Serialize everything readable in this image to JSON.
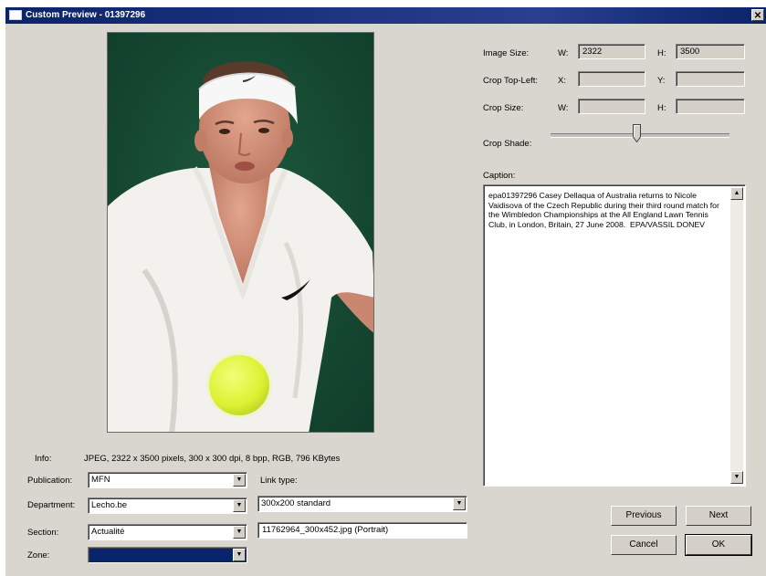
{
  "window": {
    "title": "Custom Preview - 01397296",
    "close_glyph": "✕"
  },
  "image_size": {
    "label": "Image Size:",
    "w_label": "W:",
    "w_value": "2322",
    "h_label": "H:",
    "h_value": "3500"
  },
  "crop_top_left": {
    "label": "Crop Top-Left:",
    "x_label": "X:",
    "x_value": "",
    "y_label": "Y:",
    "y_value": ""
  },
  "crop_size": {
    "label": "Crop Size:",
    "w_label": "W:",
    "w_value": "",
    "h_label": "H:",
    "h_value": ""
  },
  "crop_shade": {
    "label": "Crop Shade:",
    "level": 0.48
  },
  "caption": {
    "label": "Caption:",
    "text": "epa01397296 Casey Dellaqua of Australia returns to Nicole Vaidisova of the Czech Republic during their third round match for the Wimbledon Championships at the All England Lawn Tennis Club, in London, Britain, 27 June 2008.  EPA/VASSIL DONEV"
  },
  "info": {
    "label": "Info:",
    "value": "JPEG, 2322 x 3500 pixels, 300 x 300 dpi, 8 bpp, RGB, 796 KBytes"
  },
  "publication": {
    "label": "Publication:",
    "value": "MFN"
  },
  "department": {
    "label": "Department:",
    "value": "Lecho.be"
  },
  "section": {
    "label": "Section:",
    "value": "Actualité"
  },
  "zone": {
    "label": "Zone:",
    "value": ""
  },
  "link_type": {
    "label": "Link type:",
    "value": "300x200 standard",
    "file": "11762964_300x452.jpg (Portrait)"
  },
  "buttons": {
    "previous": "Previous",
    "next": "Next",
    "cancel": "Cancel",
    "ok": "OK"
  },
  "icons": {
    "dropdown": "chevron-down-icon",
    "scroll_up": "scroll-up-icon",
    "scroll_down": "scroll-down-icon"
  }
}
